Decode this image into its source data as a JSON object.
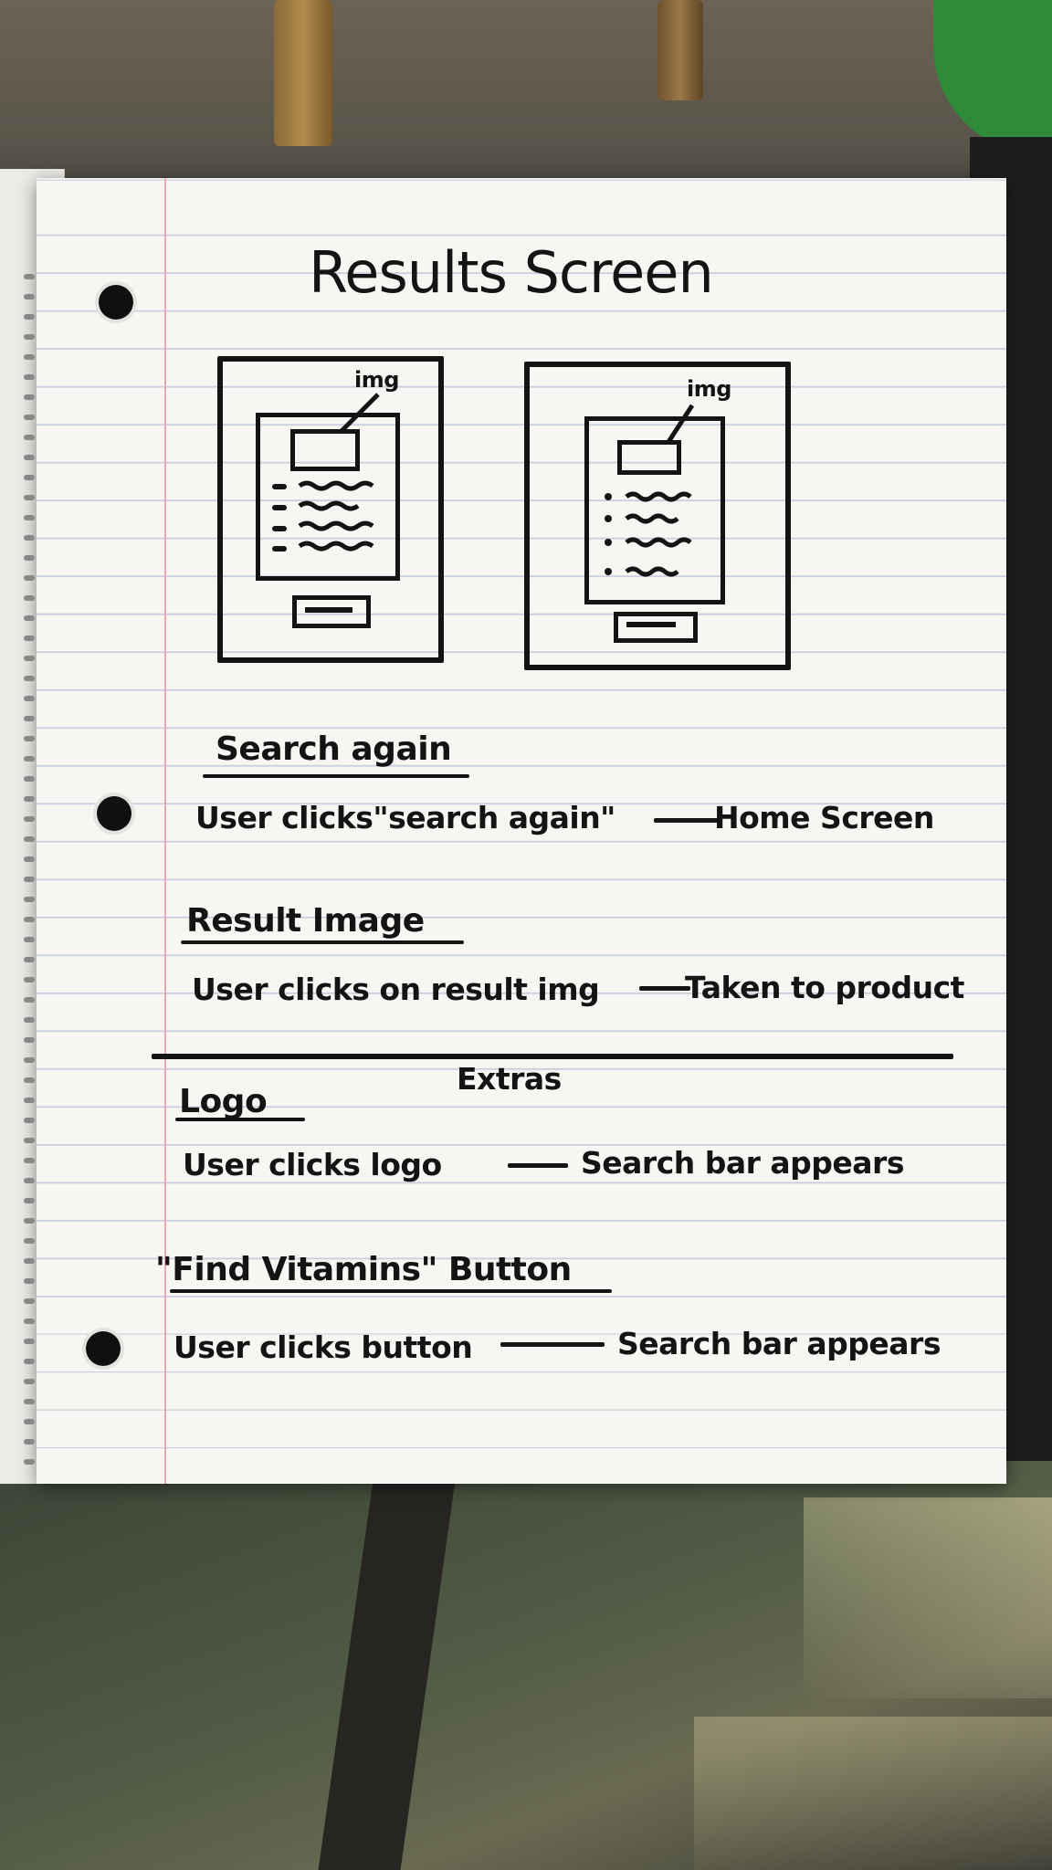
{
  "title": "Results Screen",
  "sketch_labels": {
    "left_img": "img",
    "right_img": "img"
  },
  "sections": [
    {
      "heading": "Search again",
      "line": "User clicks\"search again\"",
      "result": "Home Screen"
    },
    {
      "heading": "Result Image",
      "line": "User clicks on result img",
      "result": "Taken to product"
    }
  ],
  "extras_label": "Extras",
  "extras": [
    {
      "heading": "Logo",
      "line": "User clicks logo",
      "result": "Search bar appears"
    },
    {
      "heading": "\"Find Vitamins\" Button",
      "line": "User clicks button",
      "result": "Search bar appears"
    }
  ],
  "colors": {
    "ink": "#141414",
    "paper": "#f7f6f3",
    "rule": "#c9cfe0",
    "margin": "#e9a7b0"
  }
}
